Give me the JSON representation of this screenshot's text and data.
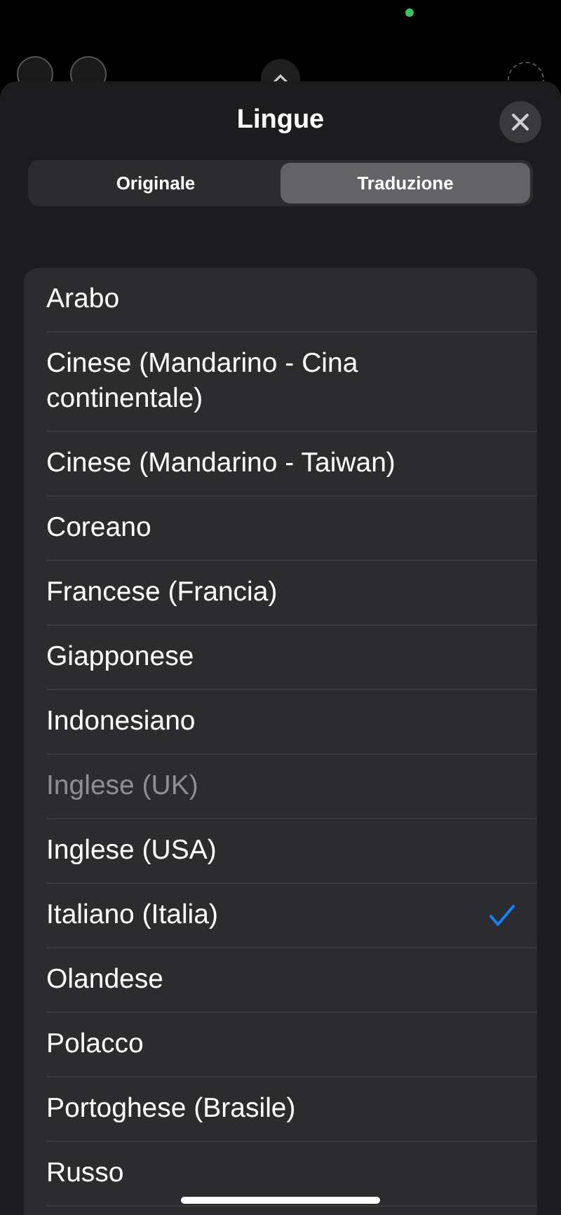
{
  "sheet": {
    "title": "Lingue"
  },
  "segments": [
    {
      "label": "Originale",
      "selected": false
    },
    {
      "label": "Traduzione",
      "selected": true
    }
  ],
  "languages": [
    {
      "label": "Arabo",
      "selected": false,
      "disabled": false
    },
    {
      "label": "Cinese (Mandarino - Cina continentale)",
      "selected": false,
      "disabled": false
    },
    {
      "label": "Cinese (Mandarino - Taiwan)",
      "selected": false,
      "disabled": false
    },
    {
      "label": "Coreano",
      "selected": false,
      "disabled": false
    },
    {
      "label": "Francese (Francia)",
      "selected": false,
      "disabled": false
    },
    {
      "label": "Giapponese",
      "selected": false,
      "disabled": false
    },
    {
      "label": "Indonesiano",
      "selected": false,
      "disabled": false
    },
    {
      "label": "Inglese (UK)",
      "selected": false,
      "disabled": true
    },
    {
      "label": "Inglese (USA)",
      "selected": false,
      "disabled": false
    },
    {
      "label": "Italiano (Italia)",
      "selected": true,
      "disabled": false
    },
    {
      "label": "Olandese",
      "selected": false,
      "disabled": false
    },
    {
      "label": "Polacco",
      "selected": false,
      "disabled": false
    },
    {
      "label": "Portoghese (Brasile)",
      "selected": false,
      "disabled": false
    },
    {
      "label": "Russo",
      "selected": false,
      "disabled": false
    }
  ]
}
